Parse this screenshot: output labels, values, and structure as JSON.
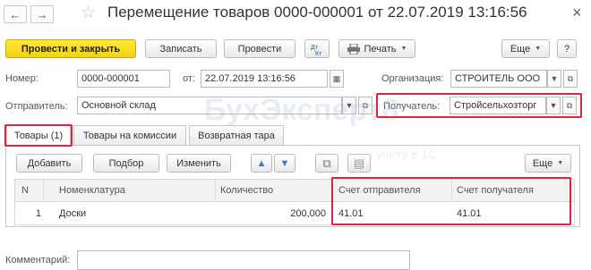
{
  "window": {
    "title": "Перемещение товаров 0000-000001 от 22.07.2019 13:16:56",
    "back_icon": "←",
    "forward_icon": "→",
    "star_icon": "☆",
    "close_icon": "×"
  },
  "toolbar": {
    "post_close_label": "Провести и закрыть",
    "save_label": "Записать",
    "post_label": "Провести",
    "print_label": "Печать",
    "more_label": "Еще",
    "help_label": "?"
  },
  "header": {
    "number_label": "Номер:",
    "number_value": "0000-000001",
    "date_label": "от:",
    "date_value": "22.07.2019 13:16:56",
    "org_label": "Организация:",
    "org_value": "СТРОИТЕЛЬ ООО",
    "sender_label": "Отправитель:",
    "sender_value": "Основной склад",
    "receiver_label": "Получатель:",
    "receiver_value": "Стройсельхозторг"
  },
  "tabs": [
    {
      "label": "Товары (1)"
    },
    {
      "label": "Товары на комиссии"
    },
    {
      "label": "Возвратная тара"
    }
  ],
  "table_toolbar": {
    "add_label": "Добавить",
    "select_label": "Подбор",
    "change_label": "Изменить",
    "more_label": "Еще"
  },
  "table": {
    "columns": [
      "N",
      "Номенклатура",
      "Количество",
      "Счет отправителя",
      "Счет получателя"
    ],
    "rows": [
      {
        "n": "1",
        "item": "Доски",
        "qty": "200,000",
        "sender_account": "41.01",
        "receiver_account": "41.01"
      }
    ]
  },
  "comment": {
    "label": "Комментарий:",
    "value": ""
  },
  "watermark": {
    "brand": "БухЭксперт8",
    "tagline": "учету в 1С"
  },
  "colors": {
    "primary_button": "#f5d20e",
    "highlight": "#d7263d",
    "border": "#b9b9b9"
  }
}
